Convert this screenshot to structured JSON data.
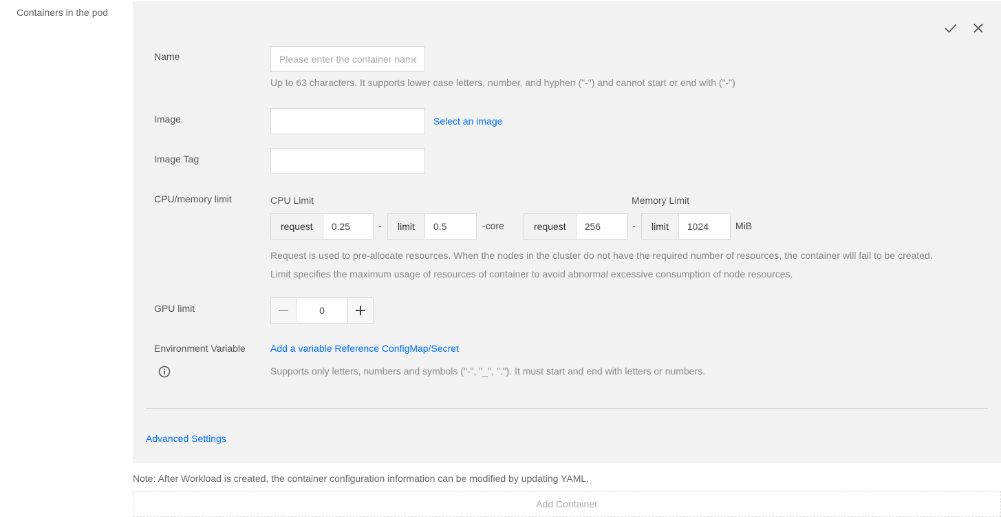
{
  "section": {
    "label": "Containers in the pod"
  },
  "form": {
    "name": {
      "label": "Name",
      "placeholder": "Please enter the container name",
      "hint": "Up to 63 characters. It supports lower case letters, number, and hyphen (\"-\") and cannot start or end with (\"-\")"
    },
    "image": {
      "label": "Image",
      "value": "",
      "link": "Select an image"
    },
    "image_tag": {
      "label": "Image Tag",
      "value": ""
    },
    "cpu_memory": {
      "label": "CPU/memory limit",
      "cpu_title": "CPU Limit",
      "memory_title": "Memory Limit",
      "request_label": "request",
      "limit_label": "limit",
      "separator": "-",
      "cpu_request": "0.25",
      "cpu_limit": "0.5",
      "cpu_unit": "-core",
      "mem_request": "256",
      "mem_limit": "1024",
      "mem_unit": "MiB",
      "hint1": "Request is used to pre-allocate resources. When the nodes in the cluster do not have the required number of resources, the container will fail to be created.",
      "hint2": "Limit specifies the maximum usage of resources of container to avoid abnormal excessive consumption of node resources."
    },
    "gpu": {
      "label": "GPU limit",
      "value": "0"
    },
    "env": {
      "label": "Environment Variable",
      "add_link": "Add a variable",
      "ref_link": "Reference ConfigMap/Secret",
      "hint": "Supports only letters, numbers and symbols (\"-\", \"_\", \".\"). It must start and end with letters or numbers."
    },
    "advanced": "Advanced Settings"
  },
  "note": "Note: After Workload is created, the container configuration information can be modified by updating YAML.",
  "add_container": "Add Container",
  "icons": {
    "confirm": "check-icon",
    "close": "close-icon",
    "info": "info-icon",
    "minus": "minus-icon",
    "plus": "plus-icon"
  },
  "colors": {
    "link": "#006eff",
    "panel_bg": "#f2f2f2"
  }
}
